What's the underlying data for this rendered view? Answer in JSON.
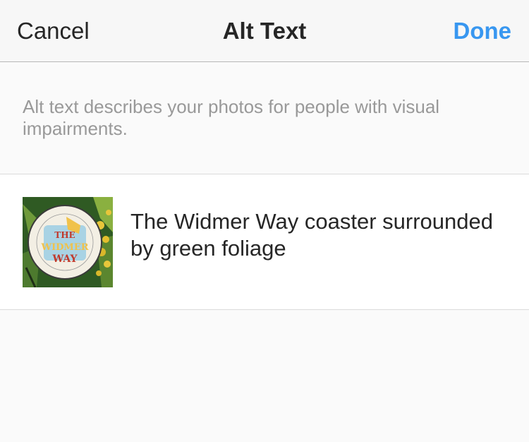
{
  "navbar": {
    "cancel_label": "Cancel",
    "title": "Alt Text",
    "done_label": "Done"
  },
  "help": {
    "text": "Alt text describes your photos for people with visual impairments."
  },
  "entry": {
    "alt_text_value": "The Widmer Way coaster surrounded by green foliage",
    "thumbnail": {
      "coaster_title_line1": "THE",
      "coaster_title_line2": "WIDMER",
      "coaster_title_line3": "WAY"
    }
  },
  "colors": {
    "accent": "#3897f0",
    "text_primary": "#262626",
    "text_secondary": "#999999",
    "background": "#fafafa"
  }
}
